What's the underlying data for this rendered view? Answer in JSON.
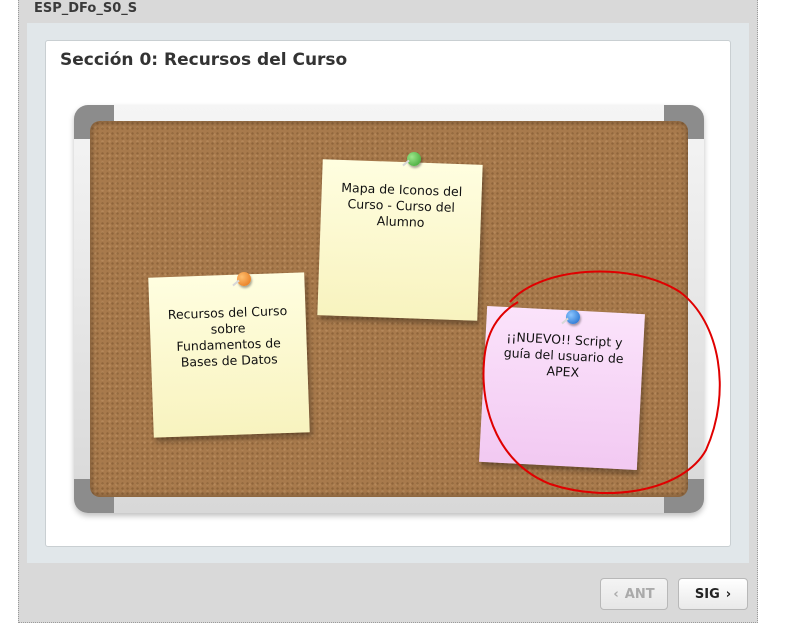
{
  "header": {
    "module_code": "ESP_DFo_S0_S"
  },
  "page": {
    "title": "Sección 0: Recursos del Curso"
  },
  "board": {
    "notes": [
      {
        "label": "Recursos del Curso\nsobre\nFundamentos de\nBases de Datos",
        "pin_color": "#e36f12"
      },
      {
        "label": "Mapa de Iconos del\nCurso - Curso del\nAlumno",
        "pin_color": "#35a02c"
      },
      {
        "label": "¡¡NUEVO!!  Script y\nguía del usuario de\nAPEX",
        "pin_color": "#1565c8",
        "highlight_color": "#e00000"
      }
    ]
  },
  "nav": {
    "prev_label": "ANT",
    "prev_icon": "chevron-left-icon",
    "prev_enabled": false,
    "next_label": "SIG",
    "next_icon": "chevron-right-icon"
  }
}
